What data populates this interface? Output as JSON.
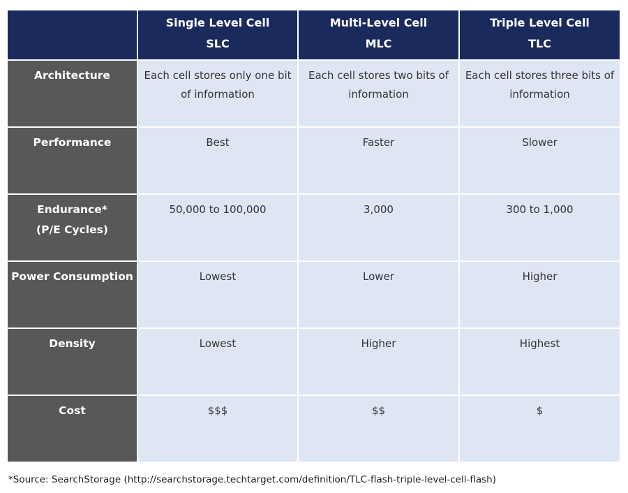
{
  "table": {
    "corner": "",
    "columns": [
      {
        "name": "Single Level Cell",
        "abbr": "SLC"
      },
      {
        "name": "Multi-Level Cell",
        "abbr": "MLC"
      },
      {
        "name": "Triple Level Cell",
        "abbr": "TLC"
      }
    ],
    "rows": [
      {
        "label": "Architecture",
        "sublabel": "",
        "values": [
          "Each cell stores only one bit of information",
          "Each cell stores two bits of information",
          "Each cell stores three bits of information"
        ]
      },
      {
        "label": "Performance",
        "sublabel": "",
        "values": [
          "Best",
          "Faster",
          "Slower"
        ]
      },
      {
        "label": "Endurance*",
        "sublabel": "(P/E Cycles)",
        "values": [
          "50,000 to 100,000",
          "3,000",
          "300 to 1,000"
        ]
      },
      {
        "label": "Power Consumption",
        "sublabel": "",
        "values": [
          "Lowest",
          "Lower",
          "Higher"
        ]
      },
      {
        "label": "Density",
        "sublabel": "",
        "values": [
          "Lowest",
          "Higher",
          "Highest"
        ]
      },
      {
        "label": "Cost",
        "sublabel": "",
        "values": [
          "$$$",
          "$$",
          "$"
        ]
      }
    ]
  },
  "footnote": "*Source: SearchStorage (http://searchstorage.techtarget.com/definition/TLC-flash-triple-level-cell-flash)",
  "colors": {
    "header_bg": "#1b2a5c",
    "label_bg": "#595757",
    "cell_bg": "#dfe6f3"
  }
}
